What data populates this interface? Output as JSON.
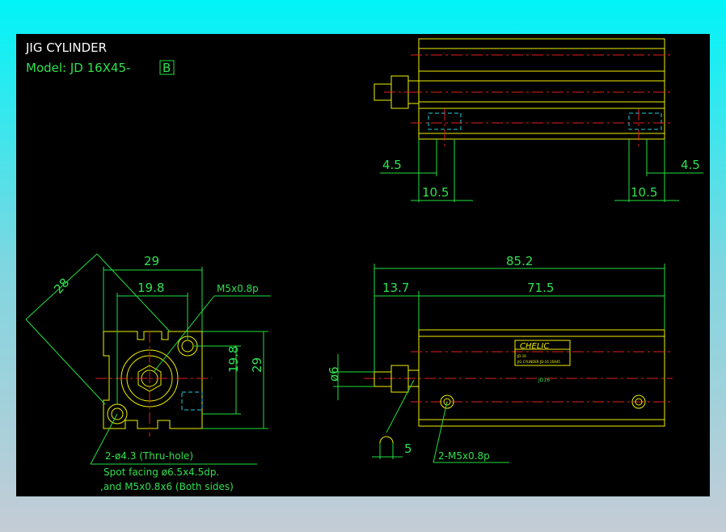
{
  "title": "JIG CYLINDER",
  "model_prefix": "Model:  JD 16X45-",
  "model_suffix": "B",
  "colors": {
    "background": "#000000",
    "outline": "#f0f000",
    "dimension": "#20e040",
    "centerline": "#e02020",
    "hidden": "#20d0e0"
  },
  "top_view": {
    "dims": [
      "4.5",
      "10.5",
      "4.5",
      "10.5"
    ]
  },
  "end_view": {
    "dims": {
      "width": "29",
      "hole_pitch_h": "19.8",
      "diagonal": "28",
      "hole_pitch_v": "19.8",
      "height": "29"
    },
    "port_label": "M5x0.8p",
    "notes": [
      "2-ø4.3 (Thru-hole)",
      "Spot facing ø6.5x4.5dp.",
      ",and M5x0.8x6 (Both sides)"
    ]
  },
  "side_view": {
    "dims": {
      "overall": "85.2",
      "rod": "13.7",
      "body": "71.5",
      "rod_dia": "ø6",
      "wrench": "5"
    },
    "port_label": "2-M5x0.8p",
    "nameplate": {
      "brand": "CHELIC",
      "line1": "JD-16",
      "line2": "JIG CYLINDER JD-16 16X45",
      "tag": "JD16"
    }
  }
}
